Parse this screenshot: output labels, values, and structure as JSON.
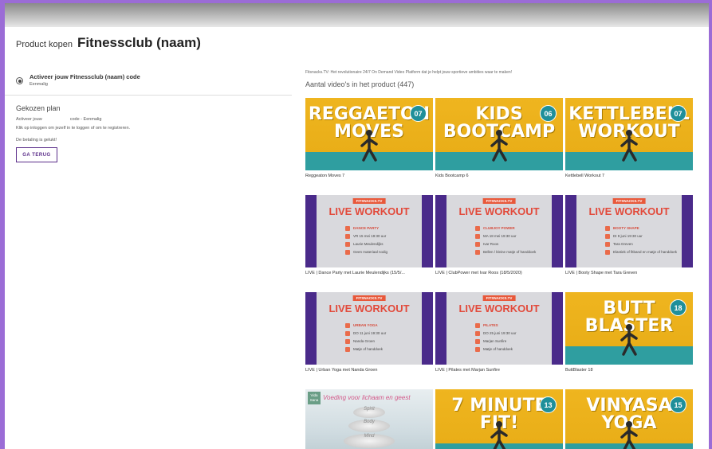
{
  "header": {
    "prefix": "Product kopen",
    "title": "Fitnessclub (naam)"
  },
  "option": {
    "title": "Activeer jouw Fitnessclub (naam) code",
    "subtitle": "Eenmalig"
  },
  "plan": {
    "heading": "Gekozen plan",
    "line1_a": "Activeer jouw",
    "line1_b": "code - Eenmalig",
    "line2": "Klik op inloggen om jezelf in te loggen of om te registreren.",
    "line3": "De betaling is gelukt!",
    "back_label": "GA TERUG"
  },
  "content": {
    "intro": "Fitsnacks.TV: Het revolutionaire 24/7 On Demand Video Platform dat je helpt jouw sportieve ambities waar te maken!",
    "count": "Aantal video's in het product (447)"
  },
  "videos": [
    {
      "caption": "Reggeaton Moves 7",
      "kind": "yellow",
      "thumb_title": "REGGAETON MOVES",
      "number": "07"
    },
    {
      "caption": "Kids Bootcamp 6",
      "kind": "yellow",
      "thumb_title": "KIDS BOOTCAMP",
      "number": "06"
    },
    {
      "caption": "Kettlebell Workout 7",
      "kind": "yellow",
      "thumb_title": "KETTLEBELL WORKOUT",
      "number": "07"
    },
    {
      "caption": "LIVE | Dance Party met Laurie Meulendijks (15/5/...",
      "kind": "live",
      "tag": "FITSNACKS.TV",
      "live_title": "LIVE WORKOUT",
      "class_name": "DANCE PARTY",
      "when": "VR 15 mei 19:30 uur",
      "trainer": "Laurie Meulendijks",
      "note": "Geen materiaal nodig"
    },
    {
      "caption": "LIVE | ClubPower met Ivar Roos (18/5/2020)",
      "kind": "live",
      "tag": "FITSNACKS.TV",
      "live_title": "LIVE WORKOUT",
      "class_name": "CLUBJOY POWER",
      "when": "MA 18 mei 19:30 uur",
      "trainer": "Ivar Roos",
      "note": "Bellen / kleine matje of handdoek"
    },
    {
      "caption": "LIVE | Booty Shape met Tara Greven",
      "kind": "live",
      "tag": "FITSNACKS.TV",
      "live_title": "LIVE WORKOUT",
      "class_name": "BOOTY SHAPE",
      "when": "DI 9 juni 19:30 uur",
      "trainer": "Tara Greven",
      "note": "Elastiek of fitband en matje of handdoek"
    },
    {
      "caption": "LIVE | Urban Yoga met Nanda Groen",
      "kind": "live",
      "tag": "FITSNACKS.TV",
      "live_title": "LIVE WORKOUT",
      "class_name": "URBAN YOGA",
      "when": "DO 11 juni 19:30 uur",
      "trainer": "Nanda Groen",
      "note": "Matje of handdoek"
    },
    {
      "caption": "LIVE | Pilates met Marjan Sunfire",
      "kind": "live",
      "tag": "FITSNACKS.TV",
      "live_title": "LIVE WORKOUT",
      "class_name": "PILATES",
      "when": "DO 25 juni 19:30 uur",
      "trainer": "Marjan Sunfire",
      "note": "Matje of handdoek"
    },
    {
      "caption": "ButtBlaster 18",
      "kind": "yellow",
      "thumb_title": "BUTT BLASTER",
      "number": "18"
    },
    {
      "caption": "Body & mind | Voeding voor lichaam & geest 1",
      "kind": "mind",
      "logo": "Vida Sana",
      "mind_title": "Voeding voor lichaam en geest",
      "stones": [
        "Spirit",
        "Body",
        "Mind"
      ],
      "tip": "Tip 1: Rust"
    },
    {
      "caption": "7 Minute Fit! 13",
      "kind": "yellow",
      "thumb_title": "7 MINUTE FIT!",
      "number": "13"
    },
    {
      "caption": "Vinyasa Yoga 15",
      "kind": "yellow",
      "thumb_title": "VINYASA YOGA",
      "number": "15"
    }
  ],
  "colors": {
    "accent": "#5b2d8a",
    "thumb_yellow": "#efb51f",
    "thumb_teal": "#1f8f9a",
    "live_purple": "#4a2a8a",
    "live_red": "#e24a3b"
  },
  "icons": {
    "radio": "radio-selected-icon",
    "calendar": "calendar-icon",
    "clock": "clock-icon",
    "person": "person-icon"
  }
}
